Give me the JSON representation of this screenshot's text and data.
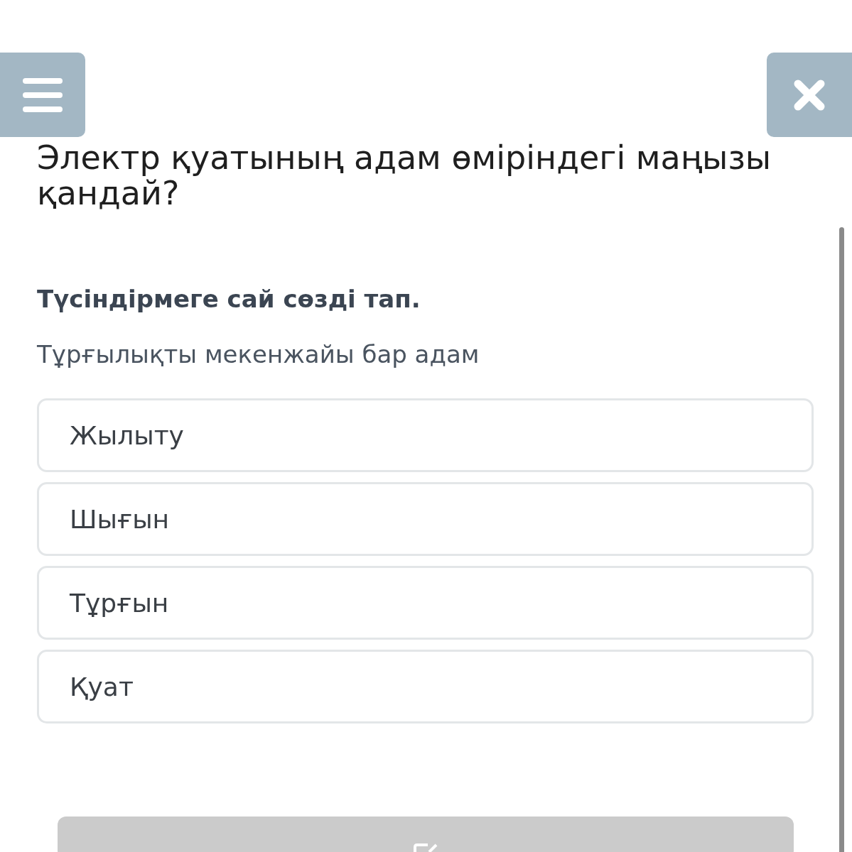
{
  "question": {
    "title": "Электр қуатының адам өміріндегі маңызы қандай?"
  },
  "task": {
    "instruction": "Түсіндірмеге сай сөзді тап.",
    "prompt": "Тұрғылықты мекенжайы бар адам"
  },
  "options": [
    {
      "label": "Жылыту",
      "selected": false
    },
    {
      "label": "Шығын",
      "selected": false
    },
    {
      "label": "Тұрғын",
      "selected": false
    },
    {
      "label": "Қуат",
      "selected": false
    }
  ],
  "submit_button": {
    "disabled": true
  }
}
